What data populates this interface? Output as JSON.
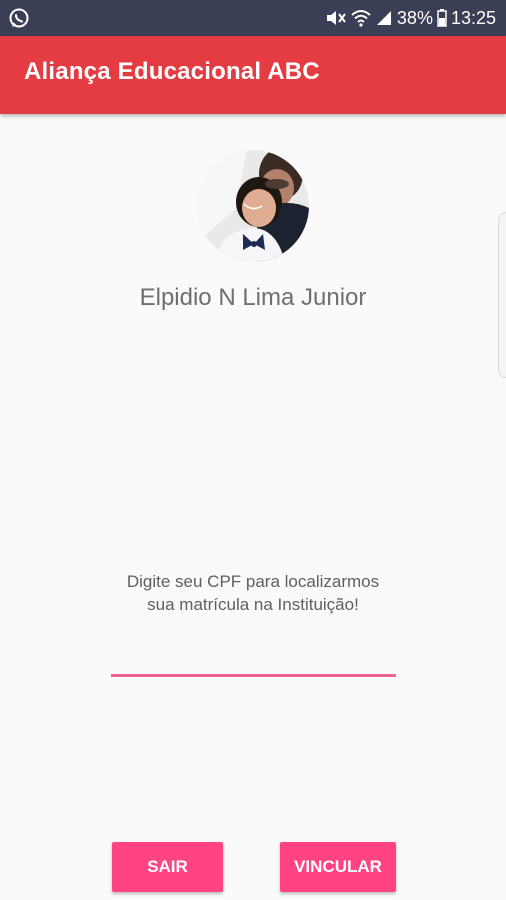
{
  "status_bar": {
    "battery": "38%",
    "time": "13:25",
    "left_icon": "whatsapp-icon",
    "right_icons": [
      "mute-icon",
      "wifi-icon",
      "signal-icon",
      "battery-icon"
    ]
  },
  "app_bar": {
    "title": "Aliança Educacional ABC",
    "color": "#e43c42"
  },
  "profile": {
    "name": "Elpidio N Lima Junior"
  },
  "form": {
    "prompt_line1": "Digite seu CPF para localizarmos",
    "prompt_line2": "sua matrícula na Instituição!",
    "cpf_value": "",
    "accent_color": "#f06292"
  },
  "actions": {
    "exit_label": "SAIR",
    "link_label": "VINCULAR",
    "button_color": "#ff4383"
  }
}
